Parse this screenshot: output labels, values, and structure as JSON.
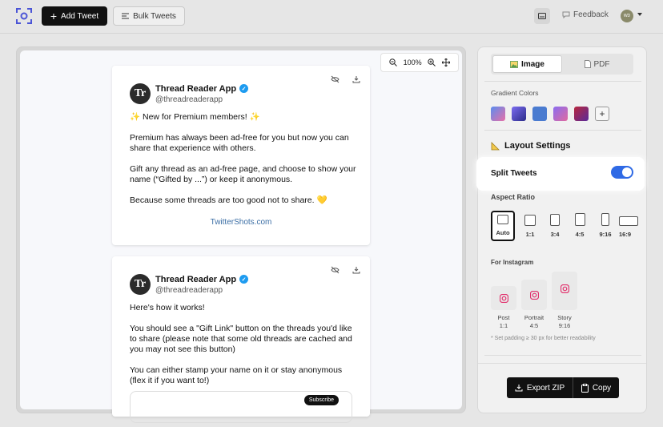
{
  "header": {
    "add_tweet_label": "Add Tweet",
    "bulk_tweets_label": "Bulk Tweets",
    "feedback_label": "Feedback",
    "avatar_text": "WD"
  },
  "zoom": {
    "level": "100%"
  },
  "tweets": [
    {
      "name": "Thread Reader App",
      "handle": "@threadreaderapp",
      "avatar_letters": "Tr",
      "paragraphs": [
        "✨ New for Premium members! ✨",
        "Premium has always been ad-free for you but now you can share that experience with others.",
        "Gift any thread as an ad-free page, and choose to show your name (“Gifted by ...”) or keep it anonymous.",
        "Because some threads are too good not to share. 💛"
      ],
      "credit": "TwitterShots.com"
    },
    {
      "name": "Thread Reader App",
      "handle": "@threadreaderapp",
      "avatar_letters": "Tr",
      "paragraphs": [
        "Here's how it works!",
        "You should see a \"Gift Link\" button on the threads you'd like to share (please note that some old threads are cached and you may not see this button)",
        "You can either stamp your name on it or stay anonymous (flex it if you want to!)"
      ],
      "embed_button": "Subscribe"
    }
  ],
  "panel": {
    "tab_image": "Image",
    "tab_pdf": "PDF",
    "gradient_label": "Gradient Colors",
    "gradients": [
      [
        "#5b8def",
        "#e76fa8"
      ],
      [
        "#7b6cf0",
        "#2c2c8a"
      ],
      [
        "#4a7bd0",
        "#4a7bd0"
      ],
      [
        "#8a6df0",
        "#e06aa0"
      ],
      [
        "#b8283e",
        "#5a2a9a"
      ]
    ],
    "layout_title": "Layout Settings",
    "split_label": "Split Tweets",
    "split_on": true,
    "aspect_label": "Aspect Ratio",
    "ratios": [
      "Auto",
      "1:1",
      "3:4",
      "4:5",
      "9:16",
      "16:9"
    ],
    "instagram_label": "For Instagram",
    "insta": [
      {
        "line1": "Post",
        "line2": "1:1"
      },
      {
        "line1": "Portrait",
        "line2": "4:5"
      },
      {
        "line1": "Story",
        "line2": "9:16"
      }
    ],
    "hint": "* Set padding ≥ 30 px for better readability",
    "export_label": "Export ZIP",
    "copy_label": "Copy"
  }
}
